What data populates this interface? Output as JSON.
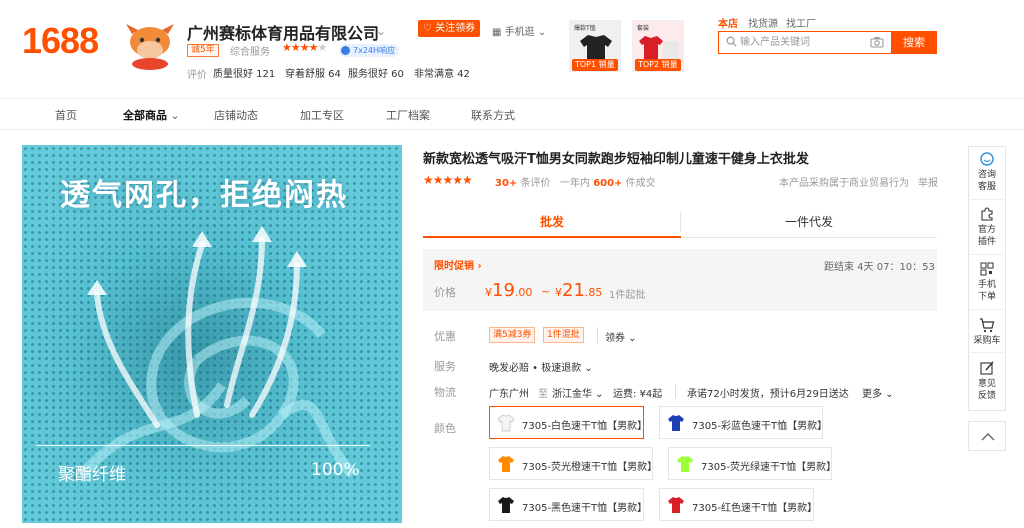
{
  "header": {
    "logo": "1688",
    "shop_name": "广州赛标体育用品有限公司",
    "years_badge": "诚5年",
    "rating_label": "综合服务",
    "rating_stars_full": "★★★★",
    "rating_stars_empty": "★",
    "service_badge": "7x24H响应",
    "eval_label": "评价",
    "evals": [
      "质量很好 121",
      "穿着舒服 64",
      "服务很好 60",
      "非常满意 42"
    ],
    "follow_button": "♡ 关注领券",
    "mobile_link": "手机逛 ⌄",
    "promos": [
      {
        "tag": "TOP1 销量",
        "image_text": "爆款T恤"
      },
      {
        "tag": "TOP2 销量",
        "image_text": "套装"
      }
    ],
    "search_tabs": [
      "本店",
      "找货源",
      "找工厂"
    ],
    "search_placeholder": "输入产品关键词",
    "search_button": "搜索"
  },
  "nav": {
    "items": [
      "首页",
      "全部商品",
      "店铺动态",
      "加工专区",
      "工厂档案",
      "联系方式"
    ]
  },
  "image": {
    "headline": "透气网孔，拒绝闷热",
    "material": "聚酯纤维",
    "percent": "100%"
  },
  "product": {
    "title": "新款宽松透气吸汗T恤男女同款跑步短袖印制儿童速干健身上衣批发",
    "stars": "★★★★★",
    "review_count": "30+",
    "review_label": "条评价",
    "sales_prefix": "一年内",
    "sales_count": "600+",
    "sales_suffix": "件成交",
    "trade_note": "本产品采购属于商业贸易行为",
    "report": "举报"
  },
  "tabs": {
    "wholesale": "批发",
    "dropship": "一件代发"
  },
  "price_box": {
    "flash_label": "限时促销 ›",
    "countdown": "距结束  4天 07：10：53",
    "price_label": "价格",
    "price1_int": "19",
    "price1_dec": ".00",
    "price2_int": "21",
    "price2_dec": ".85",
    "currency": "¥",
    "sep": "~",
    "moq": "1件起批"
  },
  "rows": {
    "offer_label": "优惠",
    "coupons": [
      "满5减3券",
      "1件混批"
    ],
    "coupon_link": "领券 ⌄",
    "service_label": "服务",
    "service_text": "晚发必赔 • 极速退款 ⌄",
    "logistics_label": "物流",
    "logistics_from": "广东广州",
    "logistics_to_word": "至",
    "logistics_to": "浙江金华 ⌄",
    "logistics_fee": "运费: ¥4起",
    "logistics_promise": "承诺72小时发货，预计6月29日送达",
    "logistics_more": "更多 ⌄",
    "color_label": "颜色"
  },
  "variants": [
    {
      "name": "7305-白色速干T恤【男款】",
      "color": "#f5f5f5"
    },
    {
      "name": "7305-彩蓝色速干T恤【男款】",
      "color": "#1f3fb5"
    },
    {
      "name": "7305-荧光橙速干T恤【男款】",
      "color": "#ff8a00"
    },
    {
      "name": "7305-荧光绿速干T恤【男款】",
      "color": "#9cff3a"
    },
    {
      "name": "7305-黑色速干T恤【男款】",
      "color": "#1a1a1a"
    },
    {
      "name": "7305-红色速干T恤【男款】",
      "color": "#d61f26"
    }
  ],
  "sidebar": {
    "items": [
      {
        "label1": "咨询",
        "label2": "客服"
      },
      {
        "label1": "官方",
        "label2": "插件"
      },
      {
        "label1": "手机",
        "label2": "下单"
      },
      {
        "label1": "采购车",
        "label2": ""
      },
      {
        "label1": "意见",
        "label2": "反馈"
      }
    ]
  },
  "colors": {
    "accent": "#ff5000",
    "fabric": "#5cc8d8"
  }
}
